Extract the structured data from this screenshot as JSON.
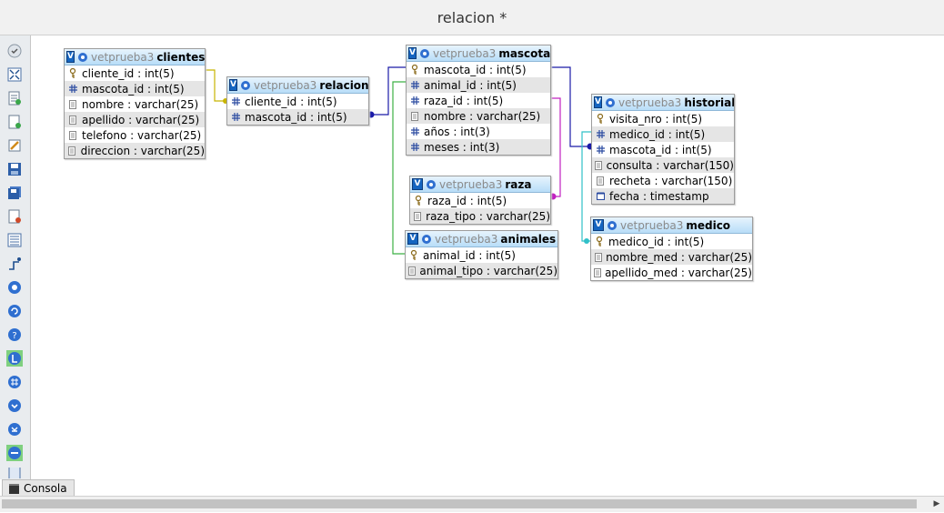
{
  "window": {
    "title": "relacion *"
  },
  "consola": {
    "label": "Consola"
  },
  "toolbar_icons": [
    "circle-check-icon",
    "fit-view-icon",
    "add-table-icon",
    "add-document-icon",
    "edit-icon",
    "save-icon",
    "save-all-icon",
    "export-icon",
    "table-list-icon",
    "relation-icon",
    "cycle-icon",
    "sync-icon",
    "help-icon",
    "toggle-left-icon",
    "grid-icon",
    "zoom-in-icon",
    "zoom-out-icon",
    "circle-minus-icon",
    "page-icon"
  ],
  "tables": [
    {
      "key": "clientes",
      "db": "vetprueba3",
      "name": "clientes",
      "fields": [
        {
          "icon": "key",
          "label": "cliente_id : int(5)"
        },
        {
          "icon": "hash",
          "label": "mascota_id : int(5)"
        },
        {
          "icon": "text",
          "label": "nombre : varchar(25)"
        },
        {
          "icon": "text",
          "label": "apellido : varchar(25)"
        },
        {
          "icon": "text",
          "label": "telefono : varchar(25)"
        },
        {
          "icon": "text",
          "label": "direccion : varchar(25)"
        }
      ]
    },
    {
      "key": "relacion",
      "db": "vetprueba3",
      "name": "relacion",
      "fields": [
        {
          "icon": "hash",
          "label": "cliente_id : int(5)"
        },
        {
          "icon": "hash",
          "label": "mascota_id : int(5)"
        }
      ]
    },
    {
      "key": "mascota",
      "db": "vetprueba3",
      "name": "mascota",
      "fields": [
        {
          "icon": "key",
          "label": "mascota_id : int(5)"
        },
        {
          "icon": "hash",
          "label": "animal_id : int(5)"
        },
        {
          "icon": "hash",
          "label": "raza_id : int(5)"
        },
        {
          "icon": "text",
          "label": "nombre : varchar(25)"
        },
        {
          "icon": "hash",
          "label": "años : int(3)"
        },
        {
          "icon": "hash",
          "label": "meses : int(3)"
        }
      ]
    },
    {
      "key": "raza",
      "db": "vetprueba3",
      "name": "raza",
      "fields": [
        {
          "icon": "key",
          "label": "raza_id : int(5)"
        },
        {
          "icon": "text",
          "label": "raza_tipo : varchar(25)"
        }
      ]
    },
    {
      "key": "animales",
      "db": "vetprueba3",
      "name": "animales",
      "fields": [
        {
          "icon": "key",
          "label": "animal_id : int(5)"
        },
        {
          "icon": "text",
          "label": "animal_tipo : varchar(25)"
        }
      ]
    },
    {
      "key": "historial",
      "db": "vetprueba3",
      "name": "historial",
      "fields": [
        {
          "icon": "key",
          "label": "visita_nro : int(5)"
        },
        {
          "icon": "hash",
          "label": "medico_id : int(5)"
        },
        {
          "icon": "hash",
          "label": "mascota_id : int(5)"
        },
        {
          "icon": "text",
          "label": "consulta : varchar(150)"
        },
        {
          "icon": "text",
          "label": "recheta : varchar(150)"
        },
        {
          "icon": "date",
          "label": "fecha : timestamp"
        }
      ]
    },
    {
      "key": "medico",
      "db": "vetprueba3",
      "name": "medico",
      "fields": [
        {
          "icon": "key",
          "label": "medico_id : int(5)"
        },
        {
          "icon": "text",
          "label": "nombre_med : varchar(25)"
        },
        {
          "icon": "text",
          "label": "apellido_med : varchar(25)"
        }
      ]
    }
  ],
  "link_colors": {
    "clientes_relacion": "#c8b400",
    "mascota_relacion": "#1a1aa8",
    "mascota_historial": "#1a1aa8",
    "animales_mascota": "#3cb043",
    "raza_mascota": "#c020c0",
    "medico_historial": "#30c0c8"
  }
}
